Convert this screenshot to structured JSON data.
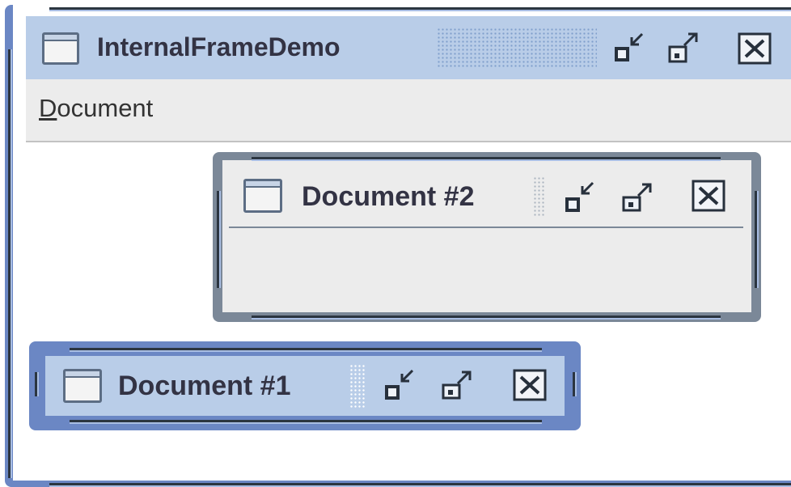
{
  "window": {
    "title": "InternalFrameDemo",
    "icons": {
      "frame": "window-icon",
      "iconify": "iconify-icon",
      "maximize": "maximize-icon",
      "close": "close-icon"
    }
  },
  "menubar": {
    "items": [
      {
        "mnemonic": "D",
        "rest": "ocument"
      }
    ]
  },
  "internal_frames": [
    {
      "title": "Document #2"
    },
    {
      "title": "Document #1"
    }
  ],
  "colors": {
    "active_border": "#6b87c4",
    "inactive_border": "#7b8898",
    "titlebar": "#b9cde8",
    "desktop": "#ffffff",
    "frame_body": "#ececec"
  }
}
